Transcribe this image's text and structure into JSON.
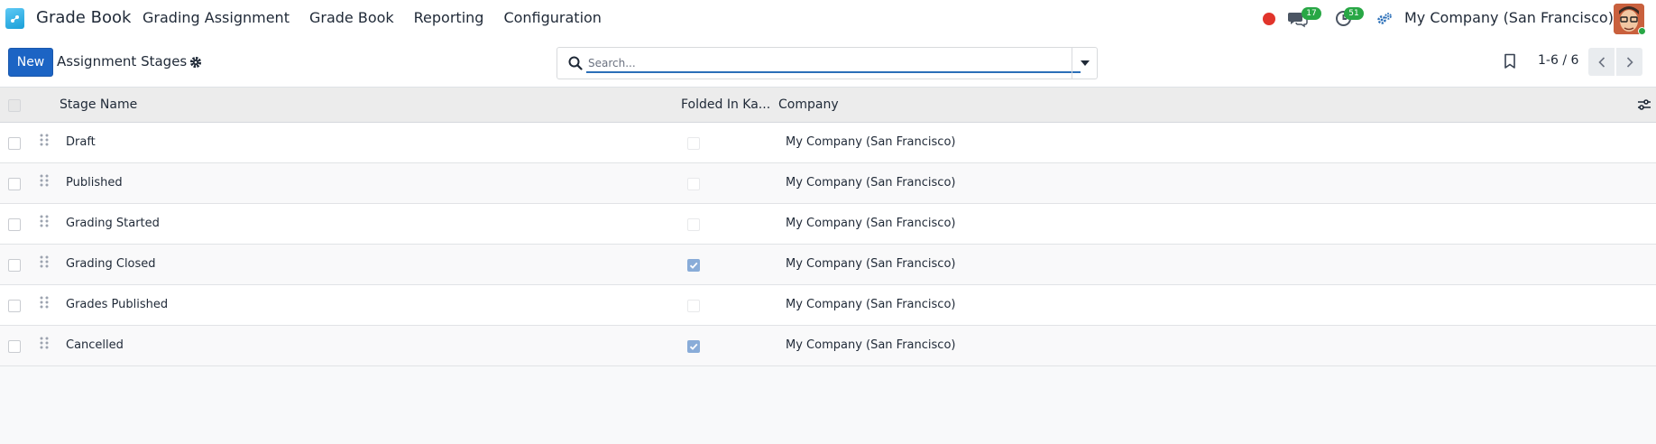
{
  "app": {
    "title": "Grade Book",
    "menu": [
      "Grading Assignment",
      "Grade Book",
      "Reporting",
      "Configuration"
    ]
  },
  "systray": {
    "messages_count": "17",
    "activities_count": "51",
    "company": "My Company (San Francisco)"
  },
  "control": {
    "new_label": "New",
    "breadcrumb": "Assignment Stages",
    "search_placeholder": "Search...",
    "pager": "1-6 / 6"
  },
  "table": {
    "columns": {
      "stage_name": "Stage Name",
      "folded": "Folded In Ka...",
      "company": "Company"
    },
    "rows": [
      {
        "name": "Draft",
        "folded": false,
        "company": "My Company (San Francisco)"
      },
      {
        "name": "Published",
        "folded": false,
        "company": "My Company (San Francisco)"
      },
      {
        "name": "Grading Started",
        "folded": false,
        "company": "My Company (San Francisco)"
      },
      {
        "name": "Grading Closed",
        "folded": true,
        "company": "My Company (San Francisco)"
      },
      {
        "name": "Grades Published",
        "folded": false,
        "company": "My Company (San Francisco)"
      },
      {
        "name": "Cancelled",
        "folded": true,
        "company": "My Company (San Francisco)"
      }
    ]
  },
  "colors": {
    "primary": "#1c64c4",
    "badge": "#28a745",
    "record": "#e1342b",
    "checked": "#89acd8"
  }
}
